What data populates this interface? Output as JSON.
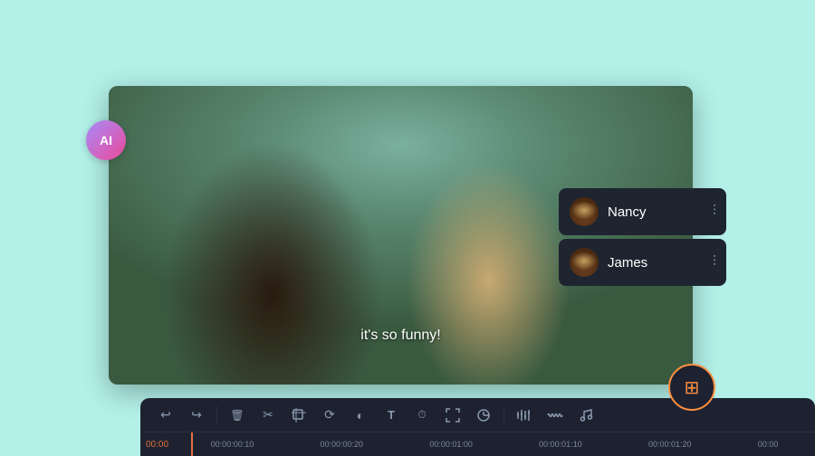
{
  "background_color": "#b2f0e8",
  "ai_badge": {
    "label": "AI"
  },
  "video": {
    "subtitle": "it's so funny!"
  },
  "speakers": [
    {
      "id": "nancy",
      "name": "Nancy",
      "waveform": "|||"
    },
    {
      "id": "james",
      "name": "James",
      "waveform": "|||"
    }
  ],
  "toolbar": {
    "buttons": [
      {
        "id": "undo",
        "label": "↩",
        "title": "Undo"
      },
      {
        "id": "redo",
        "label": "↪",
        "title": "Redo"
      },
      {
        "id": "delete",
        "label": "🗑",
        "title": "Delete"
      },
      {
        "id": "cut",
        "label": "✂",
        "title": "Cut"
      },
      {
        "id": "crop",
        "label": "⊡",
        "title": "Crop"
      },
      {
        "id": "rotate",
        "label": "⟳",
        "title": "Rotate"
      },
      {
        "id": "color",
        "label": "◐",
        "title": "Color"
      },
      {
        "id": "text",
        "label": "T",
        "title": "Text"
      },
      {
        "id": "timer",
        "label": "⏱",
        "title": "Timer"
      },
      {
        "id": "expand",
        "label": "⤢",
        "title": "Expand"
      },
      {
        "id": "filter",
        "label": "◈",
        "title": "Filter"
      },
      {
        "id": "equalizer",
        "label": "≡",
        "title": "Equalizer"
      },
      {
        "id": "wave",
        "label": "〜",
        "title": "Waveform"
      },
      {
        "id": "music",
        "label": "♪",
        "title": "Music"
      }
    ]
  },
  "timeline": {
    "current_time": "00:00",
    "timestamps": [
      "00:00:00:10",
      "00:00:00:20",
      "00:00:01:00",
      "00:00:01:10",
      "00:00:01:20",
      "00:00"
    ]
  },
  "fab": {
    "icon": "⊞",
    "title": "Edit"
  }
}
